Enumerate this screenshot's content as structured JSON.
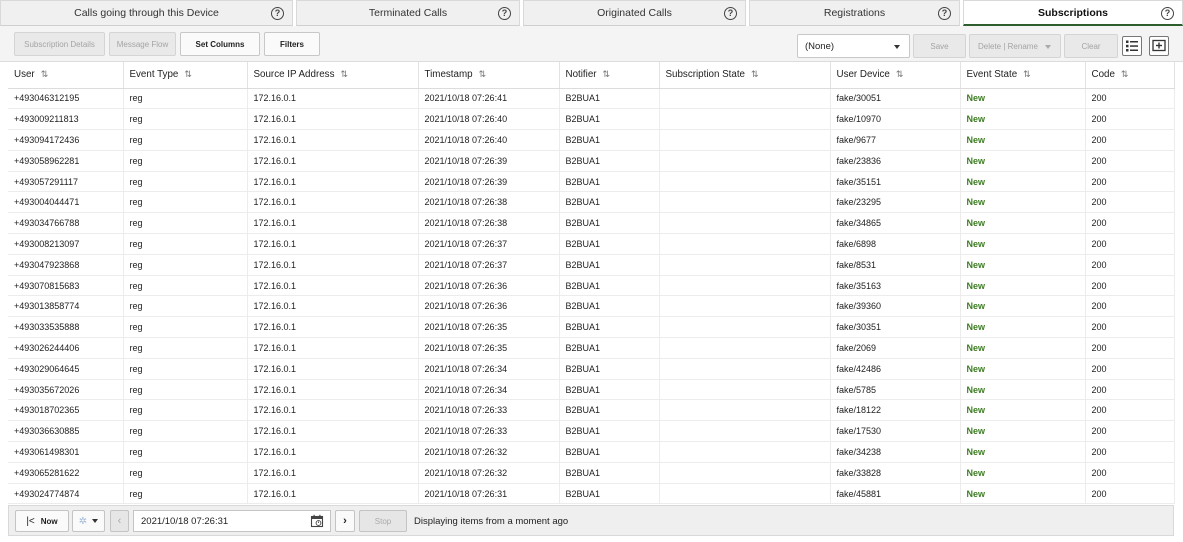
{
  "tabs": [
    {
      "label": "Calls going through this Device",
      "active": false
    },
    {
      "label": "Terminated Calls",
      "active": false
    },
    {
      "label": "Originated Calls",
      "active": false
    },
    {
      "label": "Registrations",
      "active": false
    },
    {
      "label": "Subscriptions",
      "active": true
    }
  ],
  "toolbar": {
    "subscription_details": "Subscription Details",
    "message_flow": "Message Flow",
    "set_columns": "Set Columns",
    "filters": "Filters",
    "view_select": "(None)",
    "save": "Save",
    "delete_rename": "Delete | Rename",
    "clear": "Clear"
  },
  "columns": [
    "User",
    "Event Type",
    "Source IP Address",
    "Timestamp",
    "Notifier",
    "Subscription State",
    "User Device",
    "Event State",
    "Code"
  ],
  "rows": [
    [
      "+493046312195",
      "reg",
      "172.16.0.1",
      "2021/10/18 07:26:41",
      "B2BUA1",
      "",
      "fake/30051",
      "New",
      "200"
    ],
    [
      "+493009211813",
      "reg",
      "172.16.0.1",
      "2021/10/18 07:26:40",
      "B2BUA1",
      "",
      "fake/10970",
      "New",
      "200"
    ],
    [
      "+493094172436",
      "reg",
      "172.16.0.1",
      "2021/10/18 07:26:40",
      "B2BUA1",
      "",
      "fake/9677",
      "New",
      "200"
    ],
    [
      "+493058962281",
      "reg",
      "172.16.0.1",
      "2021/10/18 07:26:39",
      "B2BUA1",
      "",
      "fake/23836",
      "New",
      "200"
    ],
    [
      "+493057291117",
      "reg",
      "172.16.0.1",
      "2021/10/18 07:26:39",
      "B2BUA1",
      "",
      "fake/35151",
      "New",
      "200"
    ],
    [
      "+493004044471",
      "reg",
      "172.16.0.1",
      "2021/10/18 07:26:38",
      "B2BUA1",
      "",
      "fake/23295",
      "New",
      "200"
    ],
    [
      "+493034766788",
      "reg",
      "172.16.0.1",
      "2021/10/18 07:26:38",
      "B2BUA1",
      "",
      "fake/34865",
      "New",
      "200"
    ],
    [
      "+493008213097",
      "reg",
      "172.16.0.1",
      "2021/10/18 07:26:37",
      "B2BUA1",
      "",
      "fake/6898",
      "New",
      "200"
    ],
    [
      "+493047923868",
      "reg",
      "172.16.0.1",
      "2021/10/18 07:26:37",
      "B2BUA1",
      "",
      "fake/8531",
      "New",
      "200"
    ],
    [
      "+493070815683",
      "reg",
      "172.16.0.1",
      "2021/10/18 07:26:36",
      "B2BUA1",
      "",
      "fake/35163",
      "New",
      "200"
    ],
    [
      "+493013858774",
      "reg",
      "172.16.0.1",
      "2021/10/18 07:26:36",
      "B2BUA1",
      "",
      "fake/39360",
      "New",
      "200"
    ],
    [
      "+493033535888",
      "reg",
      "172.16.0.1",
      "2021/10/18 07:26:35",
      "B2BUA1",
      "",
      "fake/30351",
      "New",
      "200"
    ],
    [
      "+493026244406",
      "reg",
      "172.16.0.1",
      "2021/10/18 07:26:35",
      "B2BUA1",
      "",
      "fake/2069",
      "New",
      "200"
    ],
    [
      "+493029064645",
      "reg",
      "172.16.0.1",
      "2021/10/18 07:26:34",
      "B2BUA1",
      "",
      "fake/42486",
      "New",
      "200"
    ],
    [
      "+493035672026",
      "reg",
      "172.16.0.1",
      "2021/10/18 07:26:34",
      "B2BUA1",
      "",
      "fake/5785",
      "New",
      "200"
    ],
    [
      "+493018702365",
      "reg",
      "172.16.0.1",
      "2021/10/18 07:26:33",
      "B2BUA1",
      "",
      "fake/18122",
      "New",
      "200"
    ],
    [
      "+493036630885",
      "reg",
      "172.16.0.1",
      "2021/10/18 07:26:33",
      "B2BUA1",
      "",
      "fake/17530",
      "New",
      "200"
    ],
    [
      "+493061498301",
      "reg",
      "172.16.0.1",
      "2021/10/18 07:26:32",
      "B2BUA1",
      "",
      "fake/34238",
      "New",
      "200"
    ],
    [
      "+493065281622",
      "reg",
      "172.16.0.1",
      "2021/10/18 07:26:32",
      "B2BUA1",
      "",
      "fake/33828",
      "New",
      "200"
    ],
    [
      "+493024774874",
      "reg",
      "172.16.0.1",
      "2021/10/18 07:26:31",
      "B2BUA1",
      "",
      "fake/45881",
      "New",
      "200"
    ]
  ],
  "footer": {
    "now": "Now",
    "datetime": "2021/10/18 07:26:31",
    "stop": "Stop",
    "status": "Displaying items from a moment ago"
  },
  "colors": {
    "event_state": "#3c7d22",
    "active_tab_underline": "#2e5d2e"
  }
}
